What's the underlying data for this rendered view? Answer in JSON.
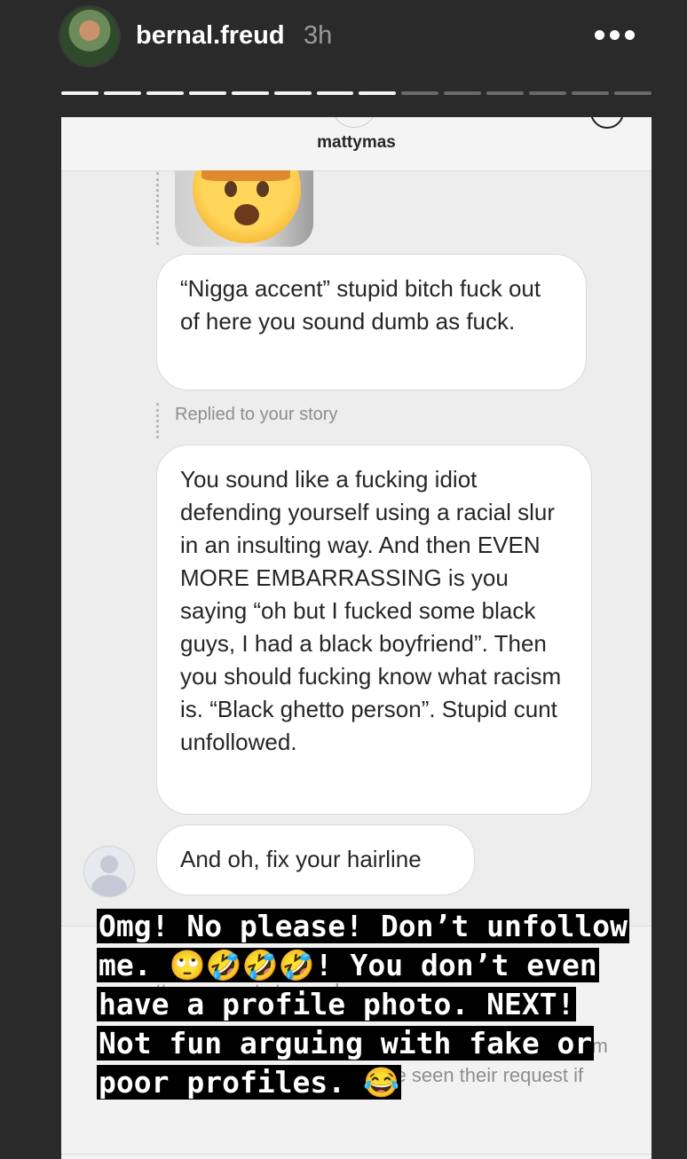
{
  "story": {
    "username": "bernal.freud",
    "time": "3h",
    "progress_done": 8,
    "progress_total": 14
  },
  "dm": {
    "title": "mattymas",
    "messages": [
      "“Nigga accent” stupid bitch fuck out of here you sound dumb as fuck.",
      "You sound like a fucking idiot defending yourself using a racial slur in an insulting way. And then EVEN MORE EMBARRASSING is you saying “oh but I fucked some black guys, I had a black boyfriend”. Then you should fucking know what racism is. “Black ghetto person”. Stupid cunt unfollowed.",
      "And oh, fix your hairline"
    ],
    "replied_label": "Replied to your story",
    "request_text_1": "mattymas wants to send you a message",
    "request_text_2": "ages from",
    "request_text_3": "now on? They'll only know you've seen their request if"
  },
  "caption": {
    "text": "Omg! No please! Don’t unfollow me. 🙄🤣🤣🤣! You don’t even have a profile photo. NEXT! Not fun arguing with fake or poor profiles. 😂"
  },
  "icons": {
    "more": "more-dots-icon",
    "sender_avatar": "default-avatar-icon",
    "emoji": "exploding-head-emoji"
  }
}
